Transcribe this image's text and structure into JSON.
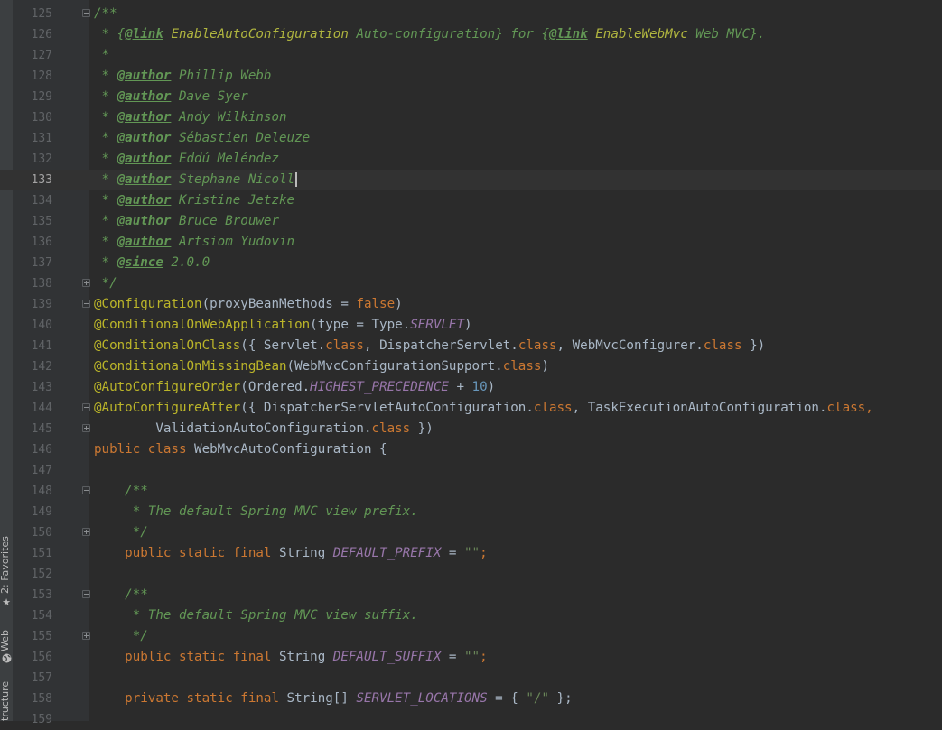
{
  "side_tabs": {
    "favorites": {
      "label": "2: Favorites",
      "icon": "star-icon"
    },
    "web": {
      "label": "Web",
      "icon": "globe-icon"
    },
    "structure": {
      "label": "tructure",
      "icon": "structure-icon"
    }
  },
  "editor": {
    "current_line": 133,
    "lines": [
      {
        "n": "125",
        "fold": "open",
        "segments": [
          {
            "t": "/**",
            "c": "cdoc"
          }
        ]
      },
      {
        "n": "126",
        "segments": [
          {
            "t": " * {",
            "c": "cdoc"
          },
          {
            "t": "@link",
            "c": "tag"
          },
          {
            "t": " ",
            "c": "cdoc"
          },
          {
            "t": "EnableAutoConfiguration",
            "c": "ref"
          },
          {
            "t": " Auto-configuration} for {",
            "c": "cdoc"
          },
          {
            "t": "@link",
            "c": "tag"
          },
          {
            "t": " ",
            "c": "cdoc"
          },
          {
            "t": "EnableWebMvc",
            "c": "ref"
          },
          {
            "t": " Web MVC}.",
            "c": "cdoc"
          }
        ]
      },
      {
        "n": "127",
        "segments": [
          {
            "t": " *",
            "c": "cdoc"
          }
        ]
      },
      {
        "n": "128",
        "segments": [
          {
            "t": " * ",
            "c": "cdoc"
          },
          {
            "t": "@author",
            "c": "tag"
          },
          {
            "t": " Phillip Webb",
            "c": "cdoc"
          }
        ]
      },
      {
        "n": "129",
        "segments": [
          {
            "t": " * ",
            "c": "cdoc"
          },
          {
            "t": "@author",
            "c": "tag"
          },
          {
            "t": " Dave Syer",
            "c": "cdoc"
          }
        ]
      },
      {
        "n": "130",
        "segments": [
          {
            "t": " * ",
            "c": "cdoc"
          },
          {
            "t": "@author",
            "c": "tag"
          },
          {
            "t": " Andy Wilkinson",
            "c": "cdoc"
          }
        ]
      },
      {
        "n": "131",
        "segments": [
          {
            "t": " * ",
            "c": "cdoc"
          },
          {
            "t": "@author",
            "c": "tag"
          },
          {
            "t": " Sébastien Deleuze",
            "c": "cdoc"
          }
        ]
      },
      {
        "n": "132",
        "segments": [
          {
            "t": " * ",
            "c": "cdoc"
          },
          {
            "t": "@author",
            "c": "tag"
          },
          {
            "t": " Eddú Meléndez",
            "c": "cdoc"
          }
        ]
      },
      {
        "n": "133",
        "caret": true,
        "segments": [
          {
            "t": " * ",
            "c": "cdoc"
          },
          {
            "t": "@author",
            "c": "tag"
          },
          {
            "t": " Stephane Nicoll",
            "c": "cdoc"
          }
        ]
      },
      {
        "n": "134",
        "segments": [
          {
            "t": " * ",
            "c": "cdoc"
          },
          {
            "t": "@author",
            "c": "tag"
          },
          {
            "t": " Kristine Jetzke",
            "c": "cdoc"
          }
        ]
      },
      {
        "n": "135",
        "segments": [
          {
            "t": " * ",
            "c": "cdoc"
          },
          {
            "t": "@author",
            "c": "tag"
          },
          {
            "t": " Bruce Brouwer",
            "c": "cdoc"
          }
        ]
      },
      {
        "n": "136",
        "segments": [
          {
            "t": " * ",
            "c": "cdoc"
          },
          {
            "t": "@author",
            "c": "tag"
          },
          {
            "t": " Artsiom Yudovin",
            "c": "cdoc"
          }
        ]
      },
      {
        "n": "137",
        "segments": [
          {
            "t": " * ",
            "c": "cdoc"
          },
          {
            "t": "@since",
            "c": "tag"
          },
          {
            "t": " 2.0.0",
            "c": "cdoc"
          }
        ]
      },
      {
        "n": "138",
        "fold": "close",
        "segments": [
          {
            "t": " */",
            "c": "cdoc"
          }
        ]
      },
      {
        "n": "139",
        "fold": "open",
        "segments": [
          {
            "t": "@Configuration",
            "c": "ann"
          },
          {
            "t": "(proxyBeanMethods = ",
            "c": ""
          },
          {
            "t": "false",
            "c": "kw"
          },
          {
            "t": ")",
            "c": ""
          }
        ]
      },
      {
        "n": "140",
        "segments": [
          {
            "t": "@ConditionalOnWebApplication",
            "c": "ann"
          },
          {
            "t": "(type = Type.",
            "c": ""
          },
          {
            "t": "SERVLET",
            "c": "fld"
          },
          {
            "t": ")",
            "c": ""
          }
        ]
      },
      {
        "n": "141",
        "segments": [
          {
            "t": "@ConditionalOnClass",
            "c": "ann"
          },
          {
            "t": "({ Servlet.",
            "c": ""
          },
          {
            "t": "class",
            "c": "kw"
          },
          {
            "t": ", DispatcherServlet.",
            "c": ""
          },
          {
            "t": "class",
            "c": "kw"
          },
          {
            "t": ", WebMvcConfigurer.",
            "c": ""
          },
          {
            "t": "class",
            "c": "kw"
          },
          {
            "t": " })",
            "c": ""
          }
        ]
      },
      {
        "n": "142",
        "segments": [
          {
            "t": "@ConditionalOnMissingBean",
            "c": "ann"
          },
          {
            "t": "(WebMvcConfigurationSupport.",
            "c": ""
          },
          {
            "t": "class",
            "c": "kw"
          },
          {
            "t": ")",
            "c": ""
          }
        ]
      },
      {
        "n": "143",
        "segments": [
          {
            "t": "@AutoConfigureOrder",
            "c": "ann"
          },
          {
            "t": "(Ordered.",
            "c": ""
          },
          {
            "t": "HIGHEST_PRECEDENCE",
            "c": "fld"
          },
          {
            "t": " + ",
            "c": ""
          },
          {
            "t": "10",
            "c": "num"
          },
          {
            "t": ")",
            "c": ""
          }
        ]
      },
      {
        "n": "144",
        "fold": "open",
        "segments": [
          {
            "t": "@AutoConfigureAfter",
            "c": "ann"
          },
          {
            "t": "({ DispatcherServletAutoConfiguration.",
            "c": ""
          },
          {
            "t": "class",
            "c": "kw"
          },
          {
            "t": ", TaskExecutionAutoConfiguration.",
            "c": ""
          },
          {
            "t": "class",
            "c": "kw"
          },
          {
            "t": ",",
            "c": "kw"
          }
        ]
      },
      {
        "n": "145",
        "fold": "close",
        "segments": [
          {
            "t": "        ValidationAutoConfiguration.",
            "c": ""
          },
          {
            "t": "class",
            "c": "kw"
          },
          {
            "t": " })",
            "c": ""
          }
        ]
      },
      {
        "n": "146",
        "segments": [
          {
            "t": "public class ",
            "c": "kw"
          },
          {
            "t": "WebMvcAutoConfiguration {",
            "c": ""
          }
        ]
      },
      {
        "n": "147",
        "segments": []
      },
      {
        "n": "148",
        "fold": "open",
        "segments": [
          {
            "t": "    /**",
            "c": "cdoc"
          }
        ]
      },
      {
        "n": "149",
        "segments": [
          {
            "t": "     * The default Spring MVC view prefix.",
            "c": "cdoc"
          }
        ]
      },
      {
        "n": "150",
        "fold": "close",
        "segments": [
          {
            "t": "     */",
            "c": "cdoc"
          }
        ]
      },
      {
        "n": "151",
        "segments": [
          {
            "t": "    public static final ",
            "c": "kw"
          },
          {
            "t": "String ",
            "c": ""
          },
          {
            "t": "DEFAULT_PREFIX",
            "c": "fld"
          },
          {
            "t": " = ",
            "c": ""
          },
          {
            "t": "\"\"",
            "c": "str"
          },
          {
            "t": ";",
            "c": "kw"
          }
        ]
      },
      {
        "n": "152",
        "segments": []
      },
      {
        "n": "153",
        "fold": "open",
        "segments": [
          {
            "t": "    /**",
            "c": "cdoc"
          }
        ]
      },
      {
        "n": "154",
        "segments": [
          {
            "t": "     * The default Spring MVC view suffix.",
            "c": "cdoc"
          }
        ]
      },
      {
        "n": "155",
        "fold": "close",
        "segments": [
          {
            "t": "     */",
            "c": "cdoc"
          }
        ]
      },
      {
        "n": "156",
        "segments": [
          {
            "t": "    public static final ",
            "c": "kw"
          },
          {
            "t": "String ",
            "c": ""
          },
          {
            "t": "DEFAULT_SUFFIX",
            "c": "fld"
          },
          {
            "t": " = ",
            "c": ""
          },
          {
            "t": "\"\"",
            "c": "str"
          },
          {
            "t": ";",
            "c": "kw"
          }
        ]
      },
      {
        "n": "157",
        "segments": []
      },
      {
        "n": "158",
        "segments": [
          {
            "t": "    private static final ",
            "c": "kw"
          },
          {
            "t": "String[] ",
            "c": ""
          },
          {
            "t": "SERVLET_LOCATIONS",
            "c": "fld"
          },
          {
            "t": " = { ",
            "c": ""
          },
          {
            "t": "\"/\"",
            "c": "str"
          },
          {
            "t": " };",
            "c": ""
          }
        ]
      },
      {
        "n": "159",
        "segments": []
      }
    ]
  }
}
